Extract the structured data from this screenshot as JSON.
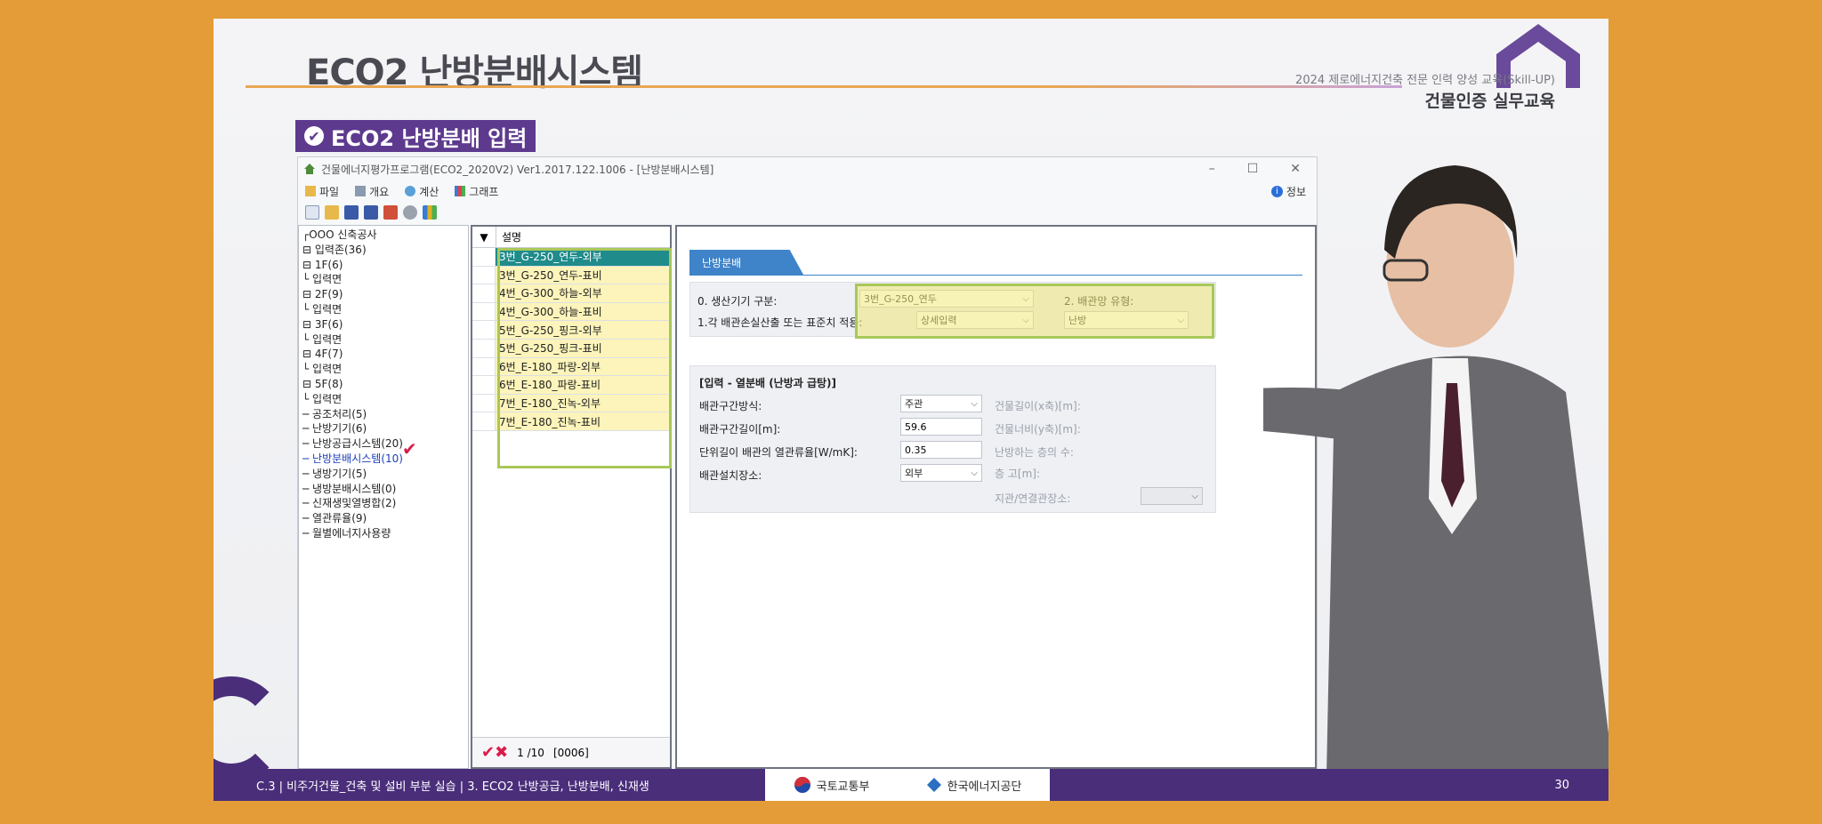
{
  "slide": {
    "title": "ECO2 난방분배시스템",
    "course_subtitle": "2024 제로에너지건축 전문 인력 양성 교육(Skill-UP)",
    "course_title": "건물인증 실무교육",
    "section_badge": "ECO2 난방분배 입력",
    "footer_text": "C.3 | 비주거건물_건축 및 설비 부분 실습 | 3. ECO2 난방공급, 난방분배, 신재생",
    "page_number": "30",
    "logo_1": "국토교통부",
    "logo_2": "한국에너지공단"
  },
  "app": {
    "window_title": "건물에너지평가프로그램(ECO2_2020V2) Ver1.2017.122.1006 - [난방분배시스템]",
    "win_min": "–",
    "win_max": "☐",
    "win_close": "✕",
    "menu": [
      "파일",
      "개요",
      "계산",
      "그래프"
    ],
    "info_label": "정보",
    "info_icon": "i"
  },
  "tree": [
    "┌OOO 신축공사",
    "⊟ 입력존(36)",
    "   ⊟ 1F(6)",
    "       └ 입력면",
    "   ⊟ 2F(9)",
    "       └ 입력면",
    "   ⊟ 3F(6)",
    "       └ 입력면",
    "   ⊟ 4F(7)",
    "       └ 입력면",
    "   ⊟ 5F(8)",
    "       └ 입력면",
    "─ 공조처리(5)",
    "─ 난방기기(6)",
    "─ 난방공급시스템(20)",
    "─ 난방분배시스템(10)",
    "─ 냉방기기(5)",
    "─ 냉방분배시스템(0)",
    "─ 신재생및열병합(2)",
    "─ 열관류율(9)",
    "─ 월별에너지사용량"
  ],
  "list": {
    "header_arrow": "▼",
    "header": "설명",
    "items": [
      "3번_G-250_연두-외부",
      "3번_G-250_연두-표비",
      "4번_G-300_하늘-외부",
      "4번_G-300_하늘-표비",
      "5번_G-250_핑크-외부",
      "5번_G-250_핑크-표비",
      "6번_E-180_파랑-외부",
      "6번_E-180_파랑-표비",
      "7번_E-180_진녹-외부",
      "7번_E-180_진녹-표비"
    ],
    "pager": "1 /10",
    "code": "[0006]",
    "check": "✔✖"
  },
  "form": {
    "tab": "난방분배",
    "label_0": "0. 생산기기 구분:",
    "value_0": "3번_G-250_연두",
    "label_2": "2. 배관망 유형:",
    "label_1": "1.각 배관손실산출 또는 표준치 적용:",
    "value_1": "상세입력",
    "value_2": "난방",
    "group_title": "[입력 - 열분배 (난방과 급탕)]",
    "pipe_method_label": "배관구간방식:",
    "pipe_method_value": "주관",
    "pipe_length_label": "배관구간길이[m]:",
    "pipe_length_value": "59.6",
    "heat_loss_label": "단위길이 배관의 열관류율[W/mK]:",
    "heat_loss_value": "0.35",
    "location_label": "배관설치장소:",
    "location_value": "외부",
    "bldg_length_label": "건물길이(x축)[m]:",
    "bldg_width_label": "건물너비(y축)[m]:",
    "floors_label": "난방하는 층의 수:",
    "height_label": "층      고[m]:",
    "branch_label": "지관/연결관장소:"
  },
  "colors": {
    "background": "#e39c37",
    "accent_purple": "#5d3a8e",
    "list_active": "#1f8b8b",
    "list_yellow": "#fcf4ba",
    "highlight_green": "#a8c85a",
    "tab_blue": "#3f83c9"
  }
}
